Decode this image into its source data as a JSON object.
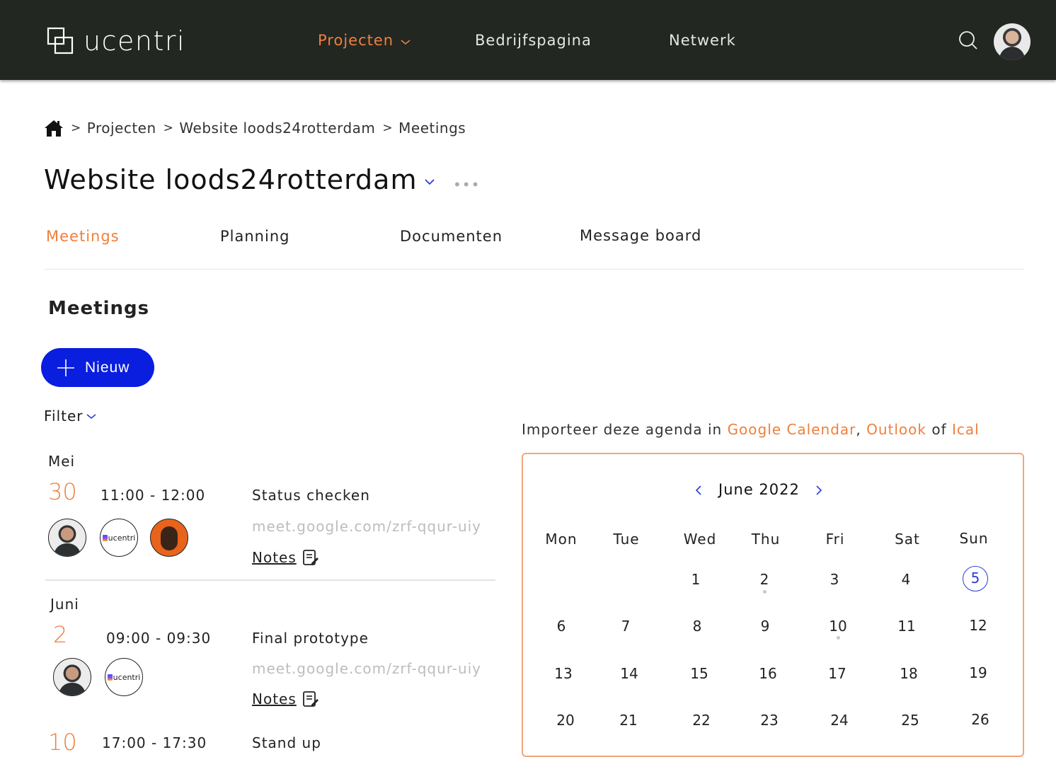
{
  "app": {
    "logo_text": "ucentri"
  },
  "nav": {
    "projecten": "Projecten",
    "bedrijfspagina": "Bedrijfspagina",
    "netwerk": "Netwerk"
  },
  "breadcrumb": {
    "items": [
      "Projecten",
      "Website loods24rotterdam",
      "Meetings"
    ],
    "separator": ">"
  },
  "page": {
    "title": "Website loods24rotterdam",
    "more": "•••"
  },
  "tabs": [
    "Meetings",
    "Planning",
    "Documenten",
    "Message board"
  ],
  "meetings_section": {
    "heading": "Meetings",
    "new_label": "Nieuw",
    "filter_label": "Filter",
    "groups": [
      {
        "month": "Mei",
        "meetings": [
          {
            "day": "30",
            "time": "11:00 - 12:00",
            "title": "Status checken",
            "link": "meet.google.com/zrf-qqur-uiy",
            "notes": "Notes",
            "avatar_logo_text": "ucentri"
          }
        ]
      },
      {
        "month": "Juni",
        "meetings": [
          {
            "day": "2",
            "time": "09:00 - 09:30",
            "title": "Final prototype",
            "link": "meet.google.com/zrf-qqur-uiy",
            "notes": "Notes",
            "avatar_logo_text": "ucentri"
          },
          {
            "day": "10",
            "time": "17:00 - 17:30",
            "title": "Stand up"
          }
        ]
      }
    ]
  },
  "import": {
    "prefix": "Importeer deze agenda in",
    "google": "Google Calendar",
    "comma": ",",
    "outlook": "Outlook",
    "of": "of",
    "ical": "Ical"
  },
  "calendar": {
    "month_label": "June 2022",
    "weekdays": [
      "Mon",
      "Tue",
      "Wed",
      "Thu",
      "Fri",
      "Sat",
      "Sun"
    ],
    "days_row1": [
      "1",
      "2",
      "3",
      "4",
      "5"
    ],
    "days_row2": [
      "6",
      "7",
      "8",
      "9",
      "10",
      "11",
      "12"
    ],
    "days_row3": [
      "13",
      "14",
      "15",
      "16",
      "17",
      "18",
      "19"
    ],
    "days_row4": [
      "20",
      "21",
      "22",
      "23",
      "24",
      "25",
      "26"
    ],
    "today": "5",
    "event_days": [
      "2",
      "10"
    ],
    "accent_color": "#f07f3c",
    "today_color": "#2b3cd6"
  },
  "colors": {
    "topbar": "#222722",
    "accent": "#f07f3c",
    "primary_button": "#0a1ee0"
  }
}
